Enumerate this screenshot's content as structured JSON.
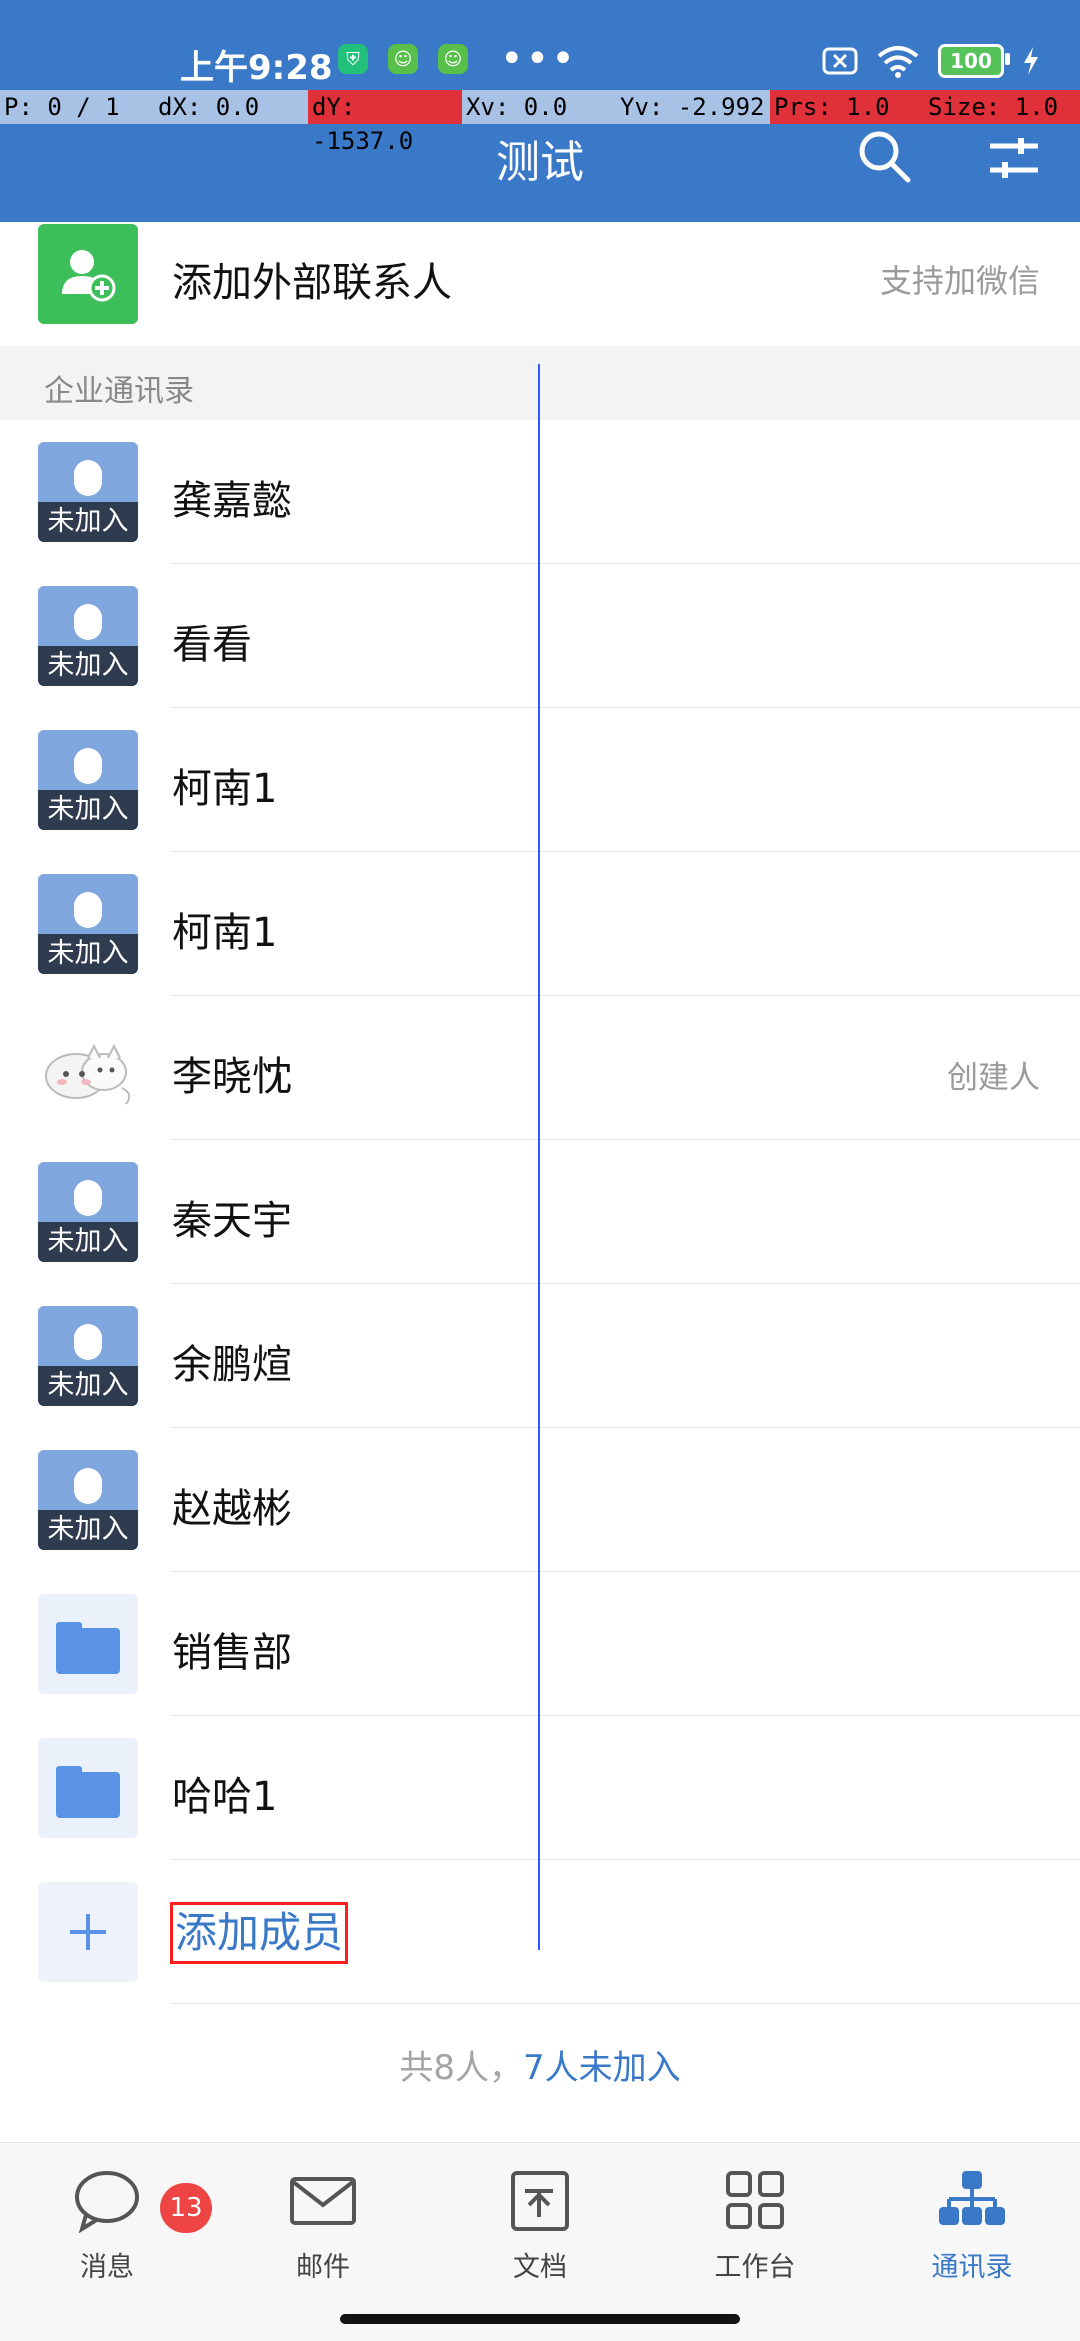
{
  "status": {
    "time": "上午9:28",
    "battery": "100"
  },
  "debug": {
    "p": "P: 0 / 1",
    "dx": "dX: 0.0",
    "dy": "dY: -1537.0",
    "xv": "Xv: 0.0",
    "yv": "Yv: -2.992",
    "prs": "Prs: 1.0",
    "size": "Size: 1.0"
  },
  "header": {
    "title": "测试"
  },
  "external": {
    "label": "添加外部联系人",
    "hint": "支持加微信"
  },
  "section": {
    "title": "企业通讯录"
  },
  "contacts": [
    {
      "name": "龚嘉懿",
      "tag": "未加入"
    },
    {
      "name": "看看",
      "tag": "未加入"
    },
    {
      "name": "柯南1",
      "tag": "未加入"
    },
    {
      "name": "柯南1",
      "tag": "未加入"
    },
    {
      "name": "李晓忱",
      "role": "创建人"
    },
    {
      "name": "秦天宇",
      "tag": "未加入"
    },
    {
      "name": "余鹏煊",
      "tag": "未加入"
    },
    {
      "name": "赵越彬",
      "tag": "未加入"
    }
  ],
  "departments": [
    {
      "name": "销售部"
    },
    {
      "name": "哈哈1"
    }
  ],
  "add_member": {
    "label": "添加成员"
  },
  "summary": {
    "total": "共8人，",
    "not_joined": "7人未加入"
  },
  "nav": {
    "messages": {
      "label": "消息",
      "badge": "13"
    },
    "mail": {
      "label": "邮件"
    },
    "docs": {
      "label": "文档"
    },
    "workbench": {
      "label": "工作台"
    },
    "contacts": {
      "label": "通讯录"
    }
  },
  "colors": {
    "brand": "#3a78c8",
    "external_icon": "#3cbf5a",
    "badge": "#ee4444"
  }
}
